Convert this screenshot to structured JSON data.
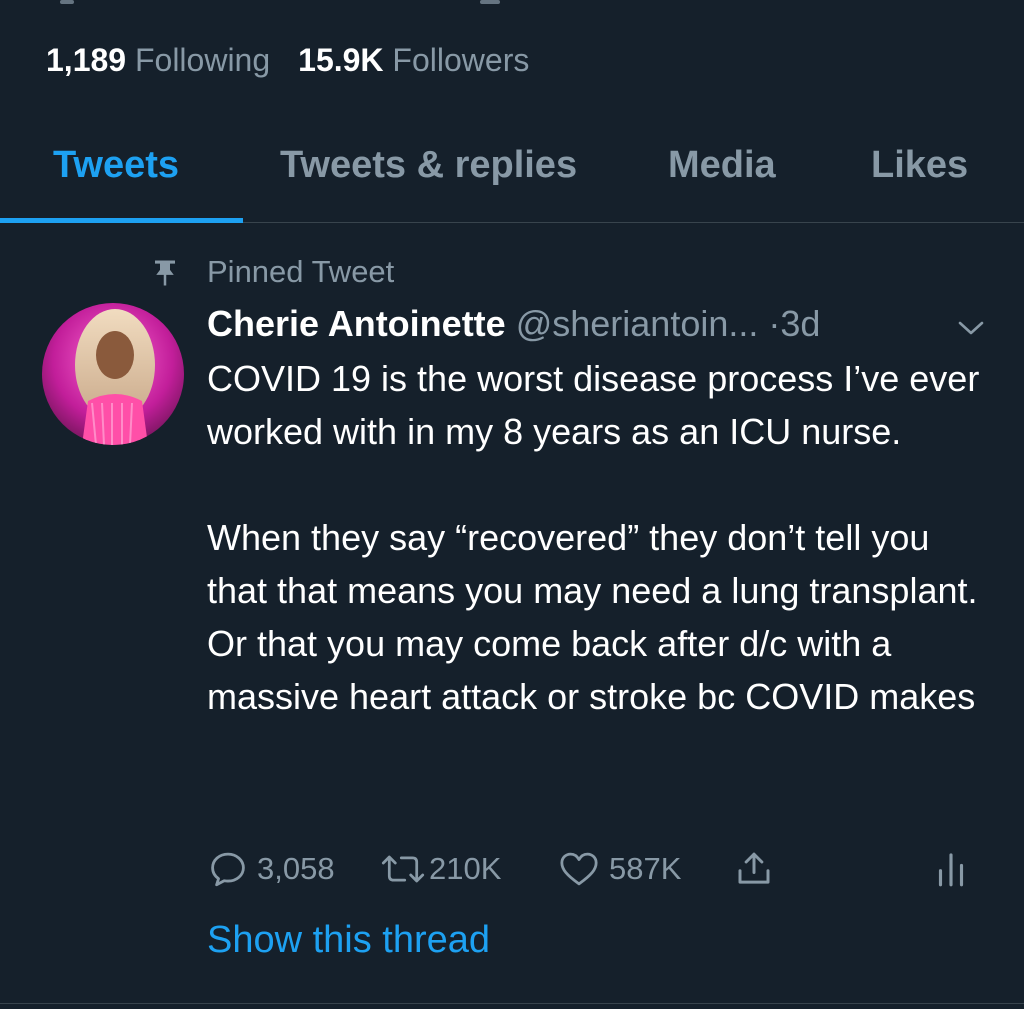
{
  "profile": {
    "following_count": "1,189",
    "following_label": "Following",
    "followers_count": "15.9K",
    "followers_label": "Followers"
  },
  "tabs": [
    {
      "label": "Tweets",
      "active": true
    },
    {
      "label": "Tweets & replies",
      "active": false
    },
    {
      "label": "Media",
      "active": false
    },
    {
      "label": "Likes",
      "active": false
    }
  ],
  "tweet": {
    "pinned_label": "Pinned Tweet",
    "author_name": "Cherie Antoinette",
    "author_handle": "@sheriantoin...",
    "separator": "·",
    "time": "3d",
    "paragraphs": [
      "COVID 19 is the worst disease process I’ve ever worked with in my 8 years as an ICU nurse.",
      "When they say “recovered” they don’t tell you that that means you may need a lung transplant. Or that you may come back after d/c with a massive heart attack or stroke bc COVID makes"
    ],
    "reply_count": "3,058",
    "retweet_count": "210K",
    "like_count": "587K",
    "show_thread_label": "Show this thread"
  },
  "icons": {
    "pin": "pin-icon",
    "chevron": "chevron-down-icon",
    "reply": "reply-icon",
    "retweet": "retweet-icon",
    "like": "heart-icon",
    "share": "share-icon",
    "analytics": "analytics-icon"
  },
  "colors": {
    "background": "#15202b",
    "accent": "#1da1f2",
    "secondary_text": "#8899a6",
    "divider": "#38444d"
  }
}
